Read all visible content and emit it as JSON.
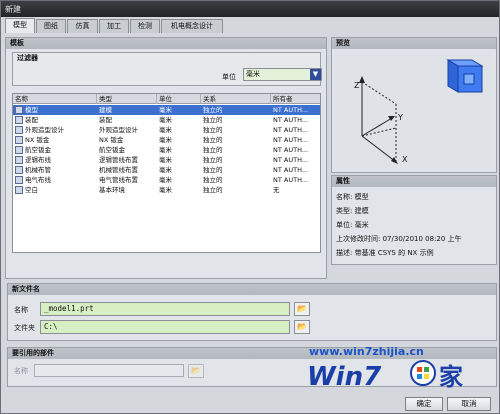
{
  "window": {
    "title": "新建"
  },
  "tabs": [
    {
      "label": "模型",
      "active": true
    },
    {
      "label": "图纸"
    },
    {
      "label": "仿真"
    },
    {
      "label": "加工"
    },
    {
      "label": "检测"
    },
    {
      "label": "机电概念设计"
    }
  ],
  "templates": {
    "title": "模板",
    "filter": {
      "title": "过滤器",
      "unit_label": "单位",
      "unit_value": "毫米"
    },
    "columns": [
      "名称",
      "类型",
      "单位",
      "关系",
      "所有者"
    ],
    "rows": [
      {
        "name": "模型",
        "type": "建模",
        "unit": "毫米",
        "relation": "独立的",
        "owner": "NT AUTH...",
        "selected": true
      },
      {
        "name": "装配",
        "type": "装配",
        "unit": "毫米",
        "relation": "独立的",
        "owner": "NT AUTH..."
      },
      {
        "name": "外观造型设计",
        "type": "外观造型设计",
        "unit": "毫米",
        "relation": "独立的",
        "owner": "NT AUTH..."
      },
      {
        "name": "NX 钣金",
        "type": "NX 钣金",
        "unit": "毫米",
        "relation": "独立的",
        "owner": "NT AUTH..."
      },
      {
        "name": "航空钣金",
        "type": "航空钣金",
        "unit": "毫米",
        "relation": "独立的",
        "owner": "NT AUTH..."
      },
      {
        "name": "逻辑布线",
        "type": "逻辑管线布置",
        "unit": "毫米",
        "relation": "独立的",
        "owner": "NT AUTH..."
      },
      {
        "name": "机械布管",
        "type": "机械管线布置",
        "unit": "毫米",
        "relation": "独立的",
        "owner": "NT AUTH..."
      },
      {
        "name": "电气布线",
        "type": "电气管线布置",
        "unit": "毫米",
        "relation": "独立的",
        "owner": "NT AUTH..."
      },
      {
        "name": "空白",
        "type": "基本环境",
        "unit": "毫米",
        "relation": "独立的",
        "owner": "无"
      }
    ]
  },
  "preview": {
    "title": "预览",
    "axis_x": "X",
    "axis_y": "Y",
    "axis_z": "Z"
  },
  "properties": {
    "title": "属性",
    "items": [
      {
        "label": "名称:",
        "value": "模型"
      },
      {
        "label": "类型:",
        "value": "建模"
      },
      {
        "label": "单位:",
        "value": "毫米"
      },
      {
        "label": "上次修改时间:",
        "value": "07/30/2010 08:20 上午"
      },
      {
        "label": "描述:",
        "value": "带基准 CSYS 的 NX 示例"
      }
    ]
  },
  "new_file": {
    "title": "新文件名",
    "name_label": "名称",
    "name_value": "_model1.prt",
    "folder_label": "文件夹",
    "folder_value": "C:\\"
  },
  "referenced_part": {
    "title": "要引用的部件",
    "name_label": "名称"
  },
  "buttons": {
    "ok": "确定",
    "cancel": "取消"
  },
  "watermark": {
    "url": "www.win7zhijia.cn",
    "logo_text": "Win7",
    "logo_suffix": "家"
  },
  "colors": {
    "selection": "#3b6fd0",
    "input_green": "#d8efc4",
    "titlebar": "#2a2b2e"
  }
}
